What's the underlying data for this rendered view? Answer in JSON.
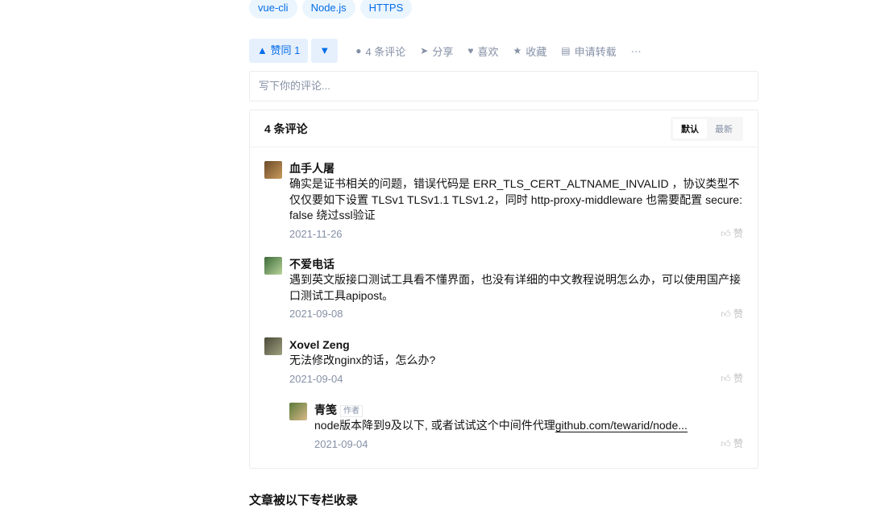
{
  "tags": [
    "vue-cli",
    "Node.js",
    "HTTPS"
  ],
  "actions": {
    "upvote": "▲ 赞同 1",
    "downvote": "▼",
    "comments": "4 条评论",
    "share": "分享",
    "like": "喜欢",
    "collect": "收藏",
    "repost": "申请转载",
    "more": "···"
  },
  "comment_input": {
    "placeholder": "写下你的评论..."
  },
  "comments_box": {
    "title": "4 条评论",
    "sort_default": "默认",
    "sort_latest": "最新",
    "like_label": "赞"
  },
  "comments": [
    {
      "author": "血手人屠",
      "text": "确实是证书相关的问题，错误代码是 ERR_TLS_CERT_ALTNAME_INVALID ，协议类型不仅仅要如下设置 TLSv1 TLSv1.1 TLSv1.2，同时 http-proxy-middleware 也需要配置 secure: false 绕过ssl验证",
      "date": "2021-11-26"
    },
    {
      "author": "不爱电话",
      "text": "遇到英文版接口测试工具看不懂界面，也没有详细的中文教程说明怎么办，可以使用国产接口测试工具apipost。",
      "date": "2021-09-08"
    },
    {
      "author": "Xovel Zeng",
      "text": "无法修改nginx的话，怎么办?",
      "date": "2021-09-04"
    },
    {
      "author": "青笺",
      "badge": "作者",
      "text": "node版本降到9及以下, 或者试试这个中间件代理",
      "link": "github.com/tewarid/node...",
      "date": "2021-09-04"
    }
  ],
  "footer": {
    "title": "文章被以下专栏收录"
  }
}
